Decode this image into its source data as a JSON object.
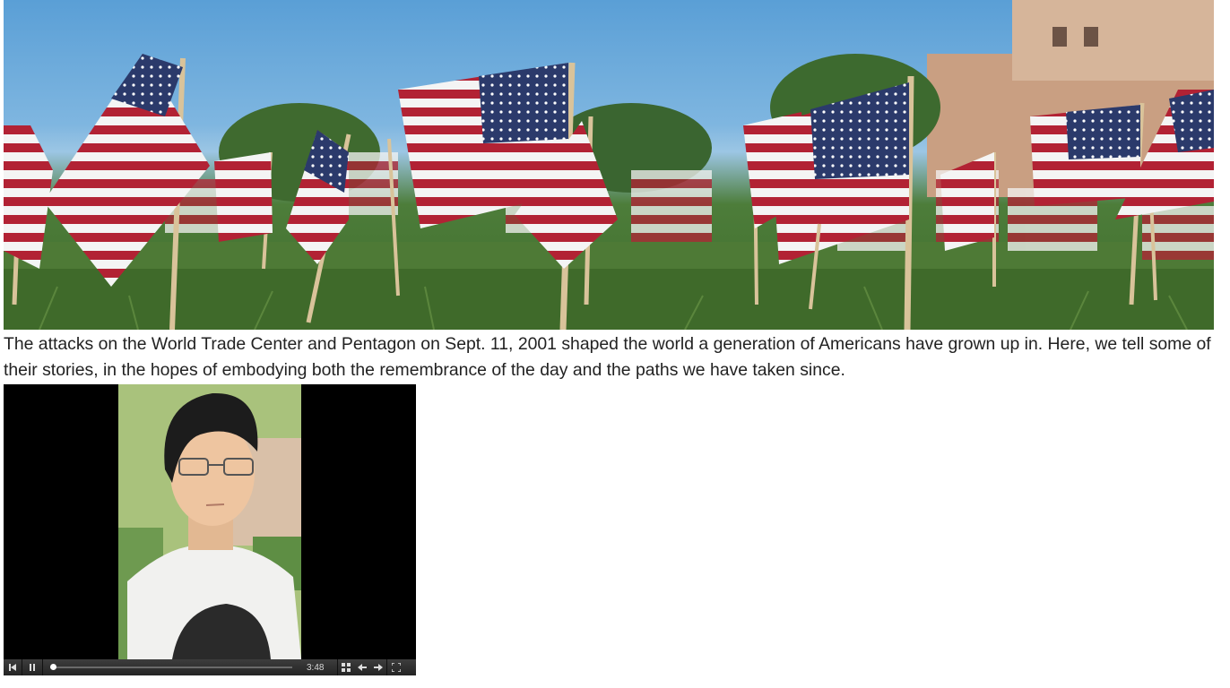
{
  "hero": {
    "image_icon": "american-flags-on-lawn-photo"
  },
  "caption": {
    "text": "The attacks on the World Trade Center and Pentagon on Sept. 11, 2001 shaped the world a generation of Americans have grown up in. Here, we tell some of their stories, in the hopes of embodying both the remembrance of the day and the paths we have taken since."
  },
  "player": {
    "photo_icon": "student-portrait-photo",
    "time": "3:48",
    "progress": 0.0,
    "controls": {
      "previous_icon": "skip-back-icon",
      "pause_icon": "pause-icon",
      "grid_icon": "grid-icon",
      "prev_slide_icon": "arrow-left-icon",
      "next_slide_icon": "arrow-right-icon",
      "fullscreen_icon": "fullscreen-icon"
    }
  }
}
